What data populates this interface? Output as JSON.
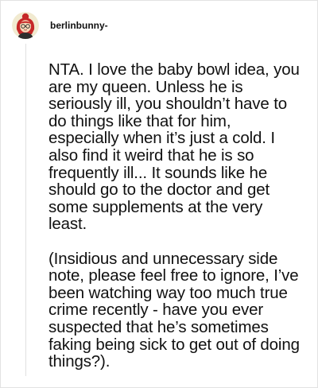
{
  "post": {
    "username": "berlinbunny-",
    "avatar_icon": "cartoon-avatar-icon",
    "paragraphs": [
      "NTA. I love the baby bowl idea, you are my queen. Unless he is seriously ill, you shouldn’t have to do things like that for him, especially when it’s just a cold. I also find it weird that he is so frequently ill... It sounds like he should go to the doctor and get some supplements at the very least.",
      "(Insidious and unnecessary side note, please feel free to ignore, I’ve been watching way too much true crime recently - have you ever suspected that he’s sometimes faking being sick to get out of doing things?)."
    ]
  },
  "colors": {
    "background": "#ffffff",
    "text": "#111111",
    "thread_line": "#e0e0e0",
    "avatar_hair": "#c62828",
    "avatar_background": "#f1ead0"
  }
}
